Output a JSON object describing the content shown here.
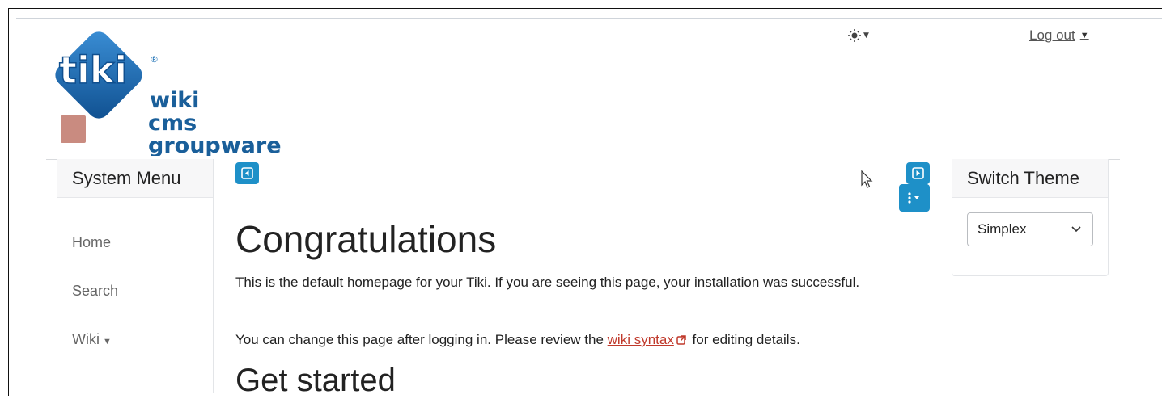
{
  "header": {
    "logo": {
      "mark_text": "tiki",
      "registered": "®",
      "lines": [
        "wiki",
        "cms",
        "groupware"
      ]
    },
    "theme_toggle_icon": "sun-icon",
    "logout_label": "Log out"
  },
  "left_panel": {
    "title": "System Menu",
    "items": [
      {
        "label": "Home",
        "has_submenu": false
      },
      {
        "label": "Search",
        "has_submenu": false
      },
      {
        "label": "Wiki",
        "has_submenu": true
      }
    ]
  },
  "main": {
    "title": "Congratulations",
    "para1": "This is the default homepage for your Tiki. If you are seeing this page, your installation was successful.",
    "para2_before": "You can change this page after logging in. Please review the ",
    "para2_link": "wiki syntax",
    "para2_after": " for editing details.",
    "subtitle": "Get started"
  },
  "right_panel": {
    "title": "Switch Theme",
    "select_value": "Simplex"
  },
  "colors": {
    "accent": "#1e90c8",
    "link": "#c0392b",
    "logo_blue": "#1a6fb5"
  }
}
